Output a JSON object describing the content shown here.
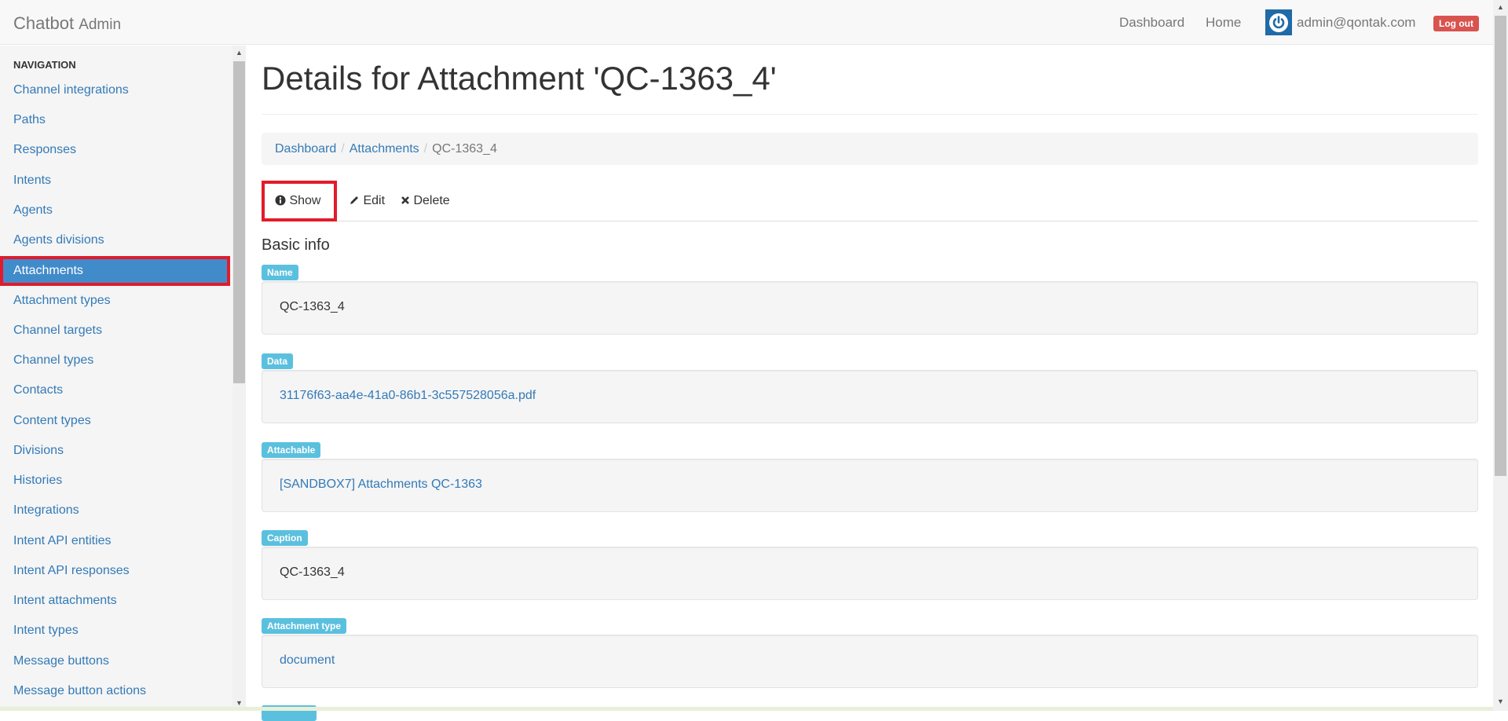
{
  "navbar": {
    "brand_main": "Chatbot",
    "brand_sub": "Admin",
    "links": [
      "Dashboard",
      "Home"
    ],
    "user_email": "admin@qontak.com",
    "logout_label": "Log out"
  },
  "sidebar": {
    "heading": "NAVIGATION",
    "items": [
      "Channel integrations",
      "Paths",
      "Responses",
      "Intents",
      "Agents",
      "Agents divisions",
      "Attachments",
      "Attachment types",
      "Channel targets",
      "Channel types",
      "Contacts",
      "Content types",
      "Divisions",
      "Histories",
      "Integrations",
      "Intent API entities",
      "Intent API responses",
      "Intent attachments",
      "Intent types",
      "Message buttons",
      "Message button actions"
    ],
    "active_item": "Attachments"
  },
  "main": {
    "title": "Details for Attachment 'QC-1363_4'",
    "breadcrumb": {
      "dashboard": "Dashboard",
      "attachments": "Attachments",
      "current": "QC-1363_4"
    },
    "tabs": {
      "show": "Show",
      "edit": "Edit",
      "delete": "Delete"
    },
    "section_title": "Basic info",
    "fields": {
      "name": {
        "label": "Name",
        "value": "QC-1363_4"
      },
      "data": {
        "label": "Data",
        "value": "31176f63-aa4e-41a0-86b1-3c557528056a.pdf"
      },
      "attachable": {
        "label": "Attachable",
        "value": "[SANDBOX7] Attachments QC-1363"
      },
      "caption": {
        "label": "Caption",
        "value": "QC-1363_4"
      },
      "attachment_type": {
        "label": "Attachment type",
        "value": "document"
      }
    }
  },
  "colors": {
    "link": "#337ab7",
    "active_nav": "#428bca",
    "highlight_border": "#e21b2a",
    "label_bg": "#5bc0de",
    "logout_bg": "#d9534f"
  }
}
